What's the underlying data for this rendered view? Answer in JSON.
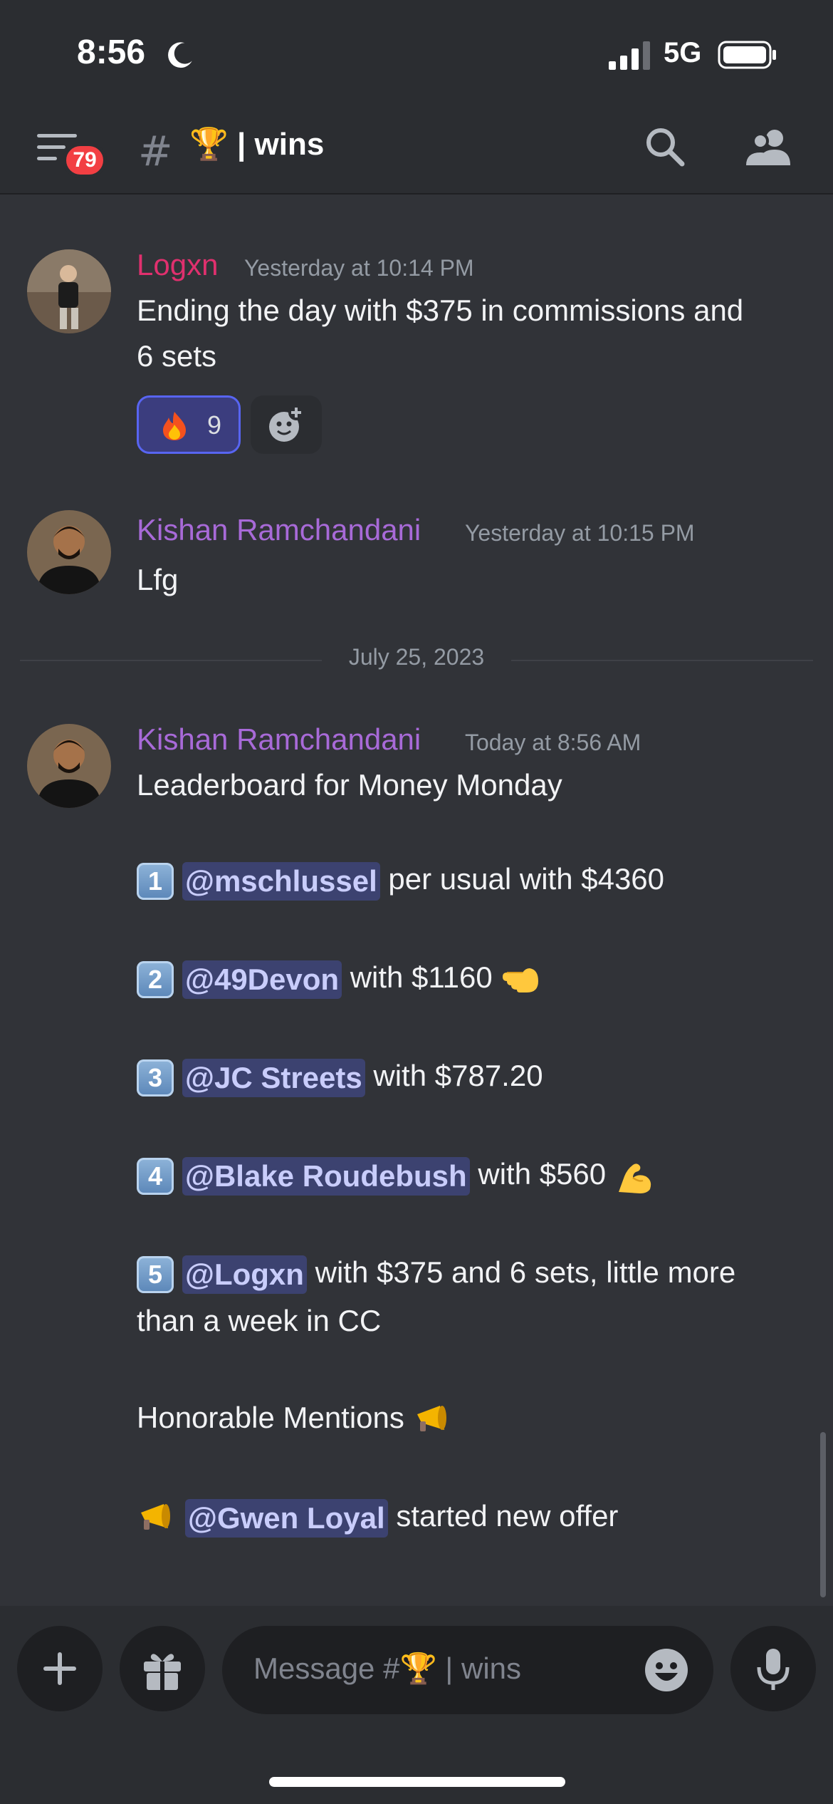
{
  "status_bar": {
    "time": "8:56",
    "network": "5G"
  },
  "header": {
    "badge_count": "79",
    "hash_symbol": "#",
    "channel_name": "🏆 | wins"
  },
  "messages": [
    {
      "author": "Logxn",
      "author_color": "#e0306e",
      "timestamp": "Yesterday at 10:14 PM",
      "lines": [
        "Ending the day with $375 in commissions and",
        "6 sets"
      ],
      "reaction": {
        "emoji": "fire",
        "count": "9"
      }
    },
    {
      "author": "Kishan Ramchandani",
      "author_color": "#a86ad8",
      "timestamp": "Yesterday at 10:15 PM",
      "lines": [
        "Lfg"
      ]
    },
    {
      "author": "Kishan Ramchandani",
      "author_color": "#a86ad8",
      "timestamp": "Today at 8:56 AM",
      "intro": "Leaderboard for Money Monday",
      "entries": [
        {
          "rank": "1",
          "mention": "@mschlussel",
          "text": " per usual with $4360"
        },
        {
          "rank": "2",
          "mention": "@49Devon",
          "text": " with $1160",
          "emoji": "pointing-hand"
        },
        {
          "rank": "3",
          "mention": "@JC Streets",
          "text": " with $787.20"
        },
        {
          "rank": "4",
          "mention": "@Blake Roudebush",
          "text": " with $560",
          "emoji": "flexed-biceps"
        },
        {
          "rank": "5",
          "mention": "@Logxn",
          "text": " with $375 and 6 sets, little more",
          "text2": "than a week in CC"
        }
      ],
      "honorable": "Honorable Mentions",
      "honorable_entry": {
        "mention": "@Gwen Loyal",
        "text": " started new offer"
      }
    }
  ],
  "date_divider": "July 25, 2023",
  "composer": {
    "placeholder": "Message #🏆 | wins"
  }
}
